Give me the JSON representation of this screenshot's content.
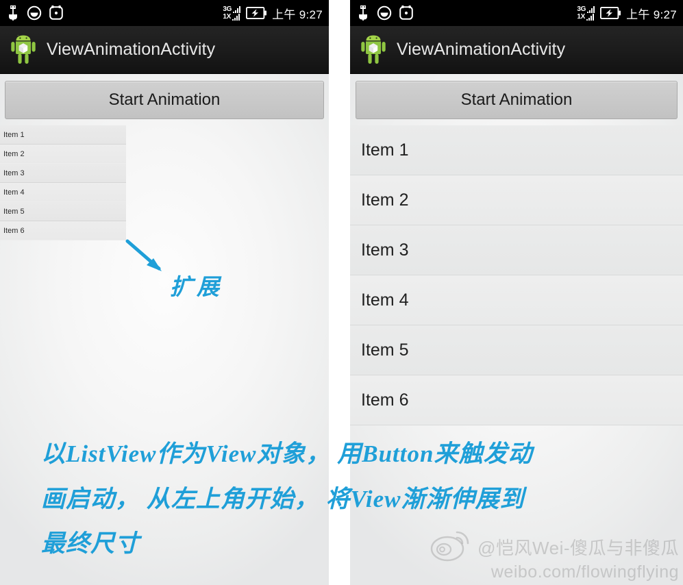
{
  "meta": {
    "description": "Side-by-side Android screenshots of ViewAnimationActivity demonstrating a ListView scale animation",
    "accent_blue": "#1f9fd8",
    "statusbar_bg": "#000000",
    "actionbar_bg": "#1b1b1b",
    "button_bg": "#c9c9c9",
    "list_bg": "#e9eaea"
  },
  "statusbar": {
    "icons_left": [
      "usb-icon",
      "smiley-face-icon",
      "alarm-clock-icon"
    ],
    "network_primary": "3G",
    "network_secondary": "1X",
    "battery_state": "charging",
    "clock": "上午 9:27"
  },
  "actionbar": {
    "app_icon": "android-robot-icon",
    "title": "ViewAnimationActivity"
  },
  "button": {
    "label": "Start Animation"
  },
  "list": {
    "items": [
      "Item 1",
      "Item 2",
      "Item 3",
      "Item 4",
      "Item 5",
      "Item 6"
    ]
  },
  "annotations": {
    "arrow_label": "扩展",
    "caption_lines": [
      "以ListView作为View对象， 用Button来触发动",
      "画启动， 从左上角开始， 将View渐渐伸展到",
      "最终尺寸"
    ]
  },
  "watermark": {
    "logo": "weibo-eye-icon",
    "handle": "@恺风Wei-傻瓜与非傻瓜",
    "url": "weibo.com/flowingflying"
  }
}
